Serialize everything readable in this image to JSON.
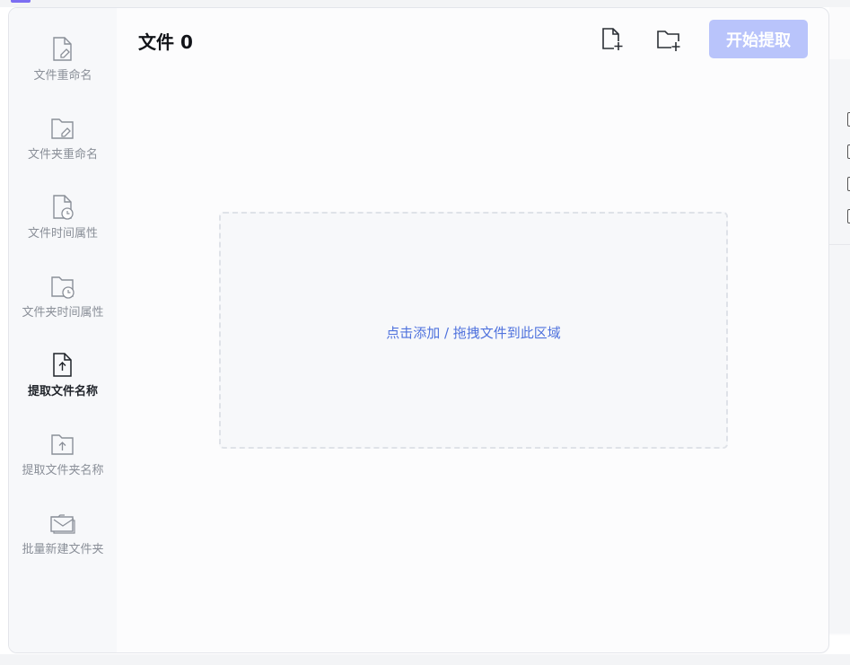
{
  "sidebar": {
    "items": [
      {
        "label": "文件重命名",
        "icon": "file-edit-icon"
      },
      {
        "label": "文件夹重命名",
        "icon": "folder-edit-icon"
      },
      {
        "label": "文件时间属性",
        "icon": "file-clock-icon"
      },
      {
        "label": "文件夹时间属性",
        "icon": "folder-clock-icon"
      },
      {
        "label": "提取文件名称",
        "icon": "file-upload-icon"
      },
      {
        "label": "提取文件夹名称",
        "icon": "folder-upload-icon"
      },
      {
        "label": "批量新建文件夹",
        "icon": "folders-mail-icon"
      }
    ],
    "active_index": 4
  },
  "main": {
    "title": "文件 0",
    "add_file_icon": "file-plus-icon",
    "add_folder_icon": "folder-plus-icon",
    "start_button_label": "开始提取",
    "dropzone_hint": "点击添加 / 拖拽文件到此区域"
  },
  "colors": {
    "primary_button": "#b9c4fb",
    "hint_text": "#4f72dd",
    "active_label": "#1f2329",
    "inactive_label": "#8a8f98"
  }
}
